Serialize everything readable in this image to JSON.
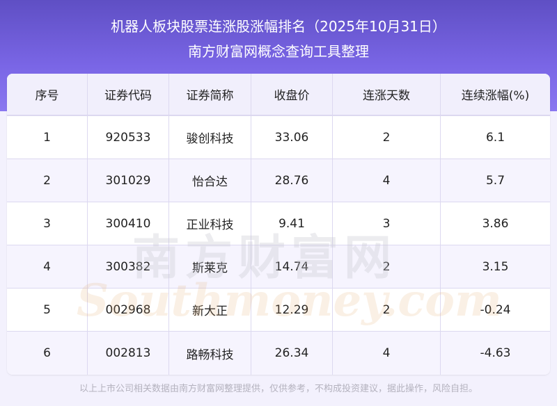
{
  "header": {
    "title": "机器人板块股票连涨股涨幅排名（2025年10月31日）",
    "subtitle": "南方财富网概念查询工具整理"
  },
  "table": {
    "columns": [
      "序号",
      "证券代码",
      "证券简称",
      "收盘价",
      "连涨天数",
      "连续涨幅(%)"
    ],
    "rows": [
      [
        "1",
        "920533",
        "骏创科技",
        "33.06",
        "2",
        "6.1"
      ],
      [
        "2",
        "301029",
        "怡合达",
        "28.76",
        "4",
        "5.7"
      ],
      [
        "3",
        "300410",
        "正业科技",
        "9.41",
        "3",
        "3.86"
      ],
      [
        "4",
        "300382",
        "斯莱克",
        "14.74",
        "2",
        "3.15"
      ],
      [
        "5",
        "002968",
        "新大正",
        "12.29",
        "2",
        "-0.24"
      ],
      [
        "6",
        "002813",
        "路畅科技",
        "26.34",
        "4",
        "-4.63"
      ]
    ]
  },
  "watermark": {
    "cn": "南方财富网",
    "en": "Southmoney.com"
  },
  "footer": "以上上市公司相关数据由南方财富网整理提供，仅供参考，不构成投资建议，据此操作，风险自担。"
}
